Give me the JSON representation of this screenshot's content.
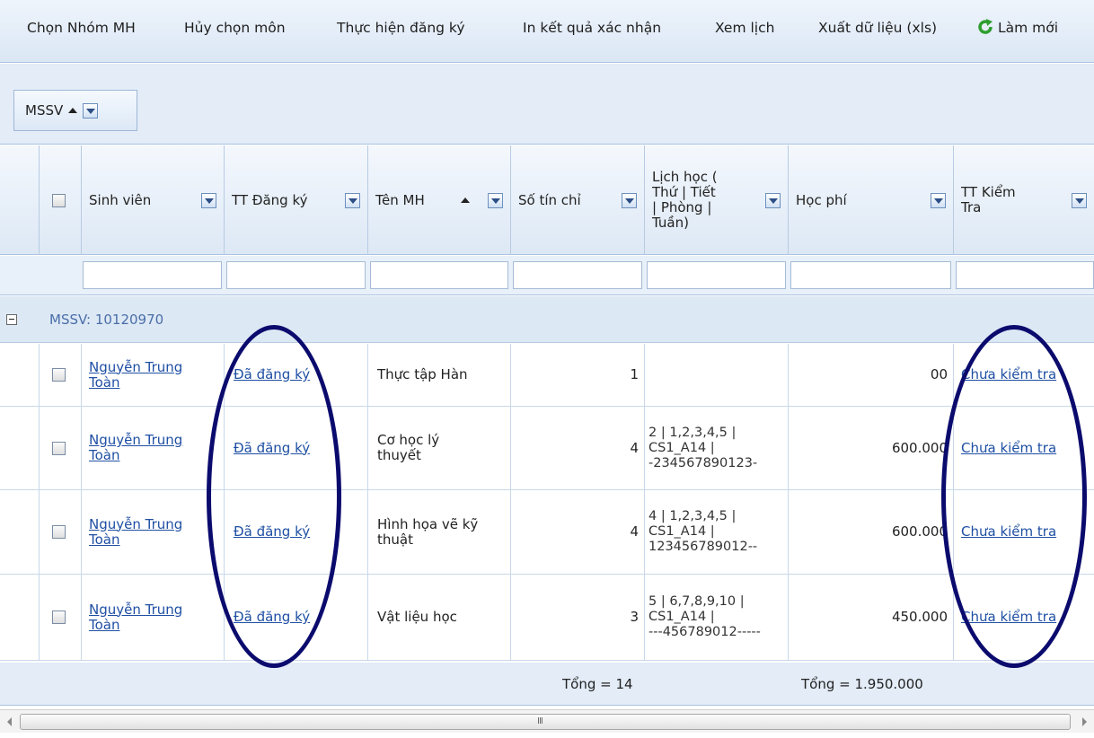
{
  "toolbar": {
    "items": [
      "Chọn Nhóm MH",
      "Hủy chọn môn",
      "Thực hiện đăng ký",
      "In kết quả xác nhận",
      "Xem lịch",
      "Xuất dữ liệu (xls)"
    ],
    "refresh_label": "Làm mới",
    "refresh_color": "#2e9e2e"
  },
  "grouping": {
    "chip_label": "MSSV"
  },
  "columns": [
    "Sinh viên",
    "TT Đăng ký",
    "Tên MH",
    "Số tín chỉ",
    "Lịch học (\nThứ | Tiết\n| Phòng |\nTuần)",
    "Học phí",
    "TT Kiểm\nTra"
  ],
  "group": {
    "label": "MSSV: 10120970"
  },
  "rows": [
    {
      "student": "Nguyễn Trung\nToàn",
      "status": "Đã đăng ký",
      "course": "Thực tập Hàn",
      "credits": "1",
      "schedule": "",
      "fee": "00",
      "check": "Chưa kiểm tra"
    },
    {
      "student": "Nguyễn Trung\nToàn",
      "status": "Đã đăng ký",
      "course": "Cơ học lý\nthuyết",
      "credits": "4",
      "schedule": "2 | 1,2,3,4,5 |\nCS1_A14 |\n-234567890123-",
      "fee": "600.000",
      "check": "Chưa kiểm tra"
    },
    {
      "student": "Nguyễn Trung\nToàn",
      "status": "Đã đăng ký",
      "course": "Hình họa vẽ kỹ\nthuật",
      "credits": "4",
      "schedule": "4 | 1,2,3,4,5 |\nCS1_A14 |\n123456789012--",
      "fee": "600.000",
      "check": "Chưa kiểm tra"
    },
    {
      "student": "Nguyễn Trung\nToàn",
      "status": "Đã đăng ký",
      "course": "Vật liệu học",
      "credits": "3",
      "schedule": "5 | 6,7,8,9,10 |\nCS1_A14 |\n---456789012-----",
      "fee": "450.000",
      "check": "Chưa kiểm tra"
    }
  ],
  "footer": {
    "credits_total": "Tổng = 14",
    "fee_total": "Tổng = 1.950.000"
  },
  "scrollbar": {
    "grip": "III"
  },
  "annotation_color": "#0b0b6e"
}
